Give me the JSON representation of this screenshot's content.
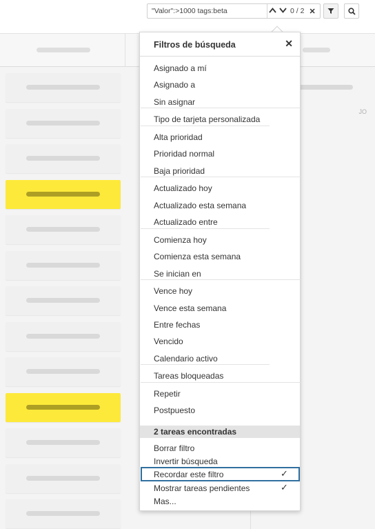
{
  "search": {
    "value": "\"Valor\":>1000 tags:beta",
    "counter": "0 / 2",
    "up_icon": "chevron-up-icon",
    "down_icon": "chevron-down-icon",
    "clear_icon": "close-icon",
    "filter_icon": "funnel-icon",
    "search_icon": "magnifier-icon"
  },
  "board": {
    "avatar_initials": "JO",
    "highlight_color": "#fde93a"
  },
  "popup": {
    "title": "Filtros de búsqueda",
    "close_icon": "close-icon",
    "groups": [
      [
        "Asignado a mí",
        "Asignado a",
        "Sin asignar"
      ],
      [
        "Tipo de tarjeta personalizada"
      ],
      [
        "Alta prioridad",
        "Prioridad normal",
        "Baja prioridad"
      ],
      [
        "Actualizado hoy",
        "Actualizado esta semana",
        "Actualizado entre"
      ],
      [
        "Comienza hoy",
        "Comienza esta semana",
        "Se inician en"
      ],
      [
        "Vence hoy",
        "Vence esta semana",
        "Entre fechas",
        "Vencido",
        "Calendario activo"
      ],
      [
        "Tareas bloqueadas"
      ],
      [
        "Repetir",
        "Postpuesto"
      ]
    ],
    "found": "2 tareas encontradas",
    "actions": [
      {
        "label": "Borrar filtro",
        "checked": false
      },
      {
        "label": "Invertir búsqueda",
        "checked": false
      },
      {
        "label": "Recordar este filtro",
        "checked": true,
        "selected": true
      },
      {
        "label": "Mostrar tareas pendientes",
        "checked": true
      },
      {
        "label": "Mas...",
        "checked": false
      }
    ],
    "check_glyph": "✓"
  }
}
